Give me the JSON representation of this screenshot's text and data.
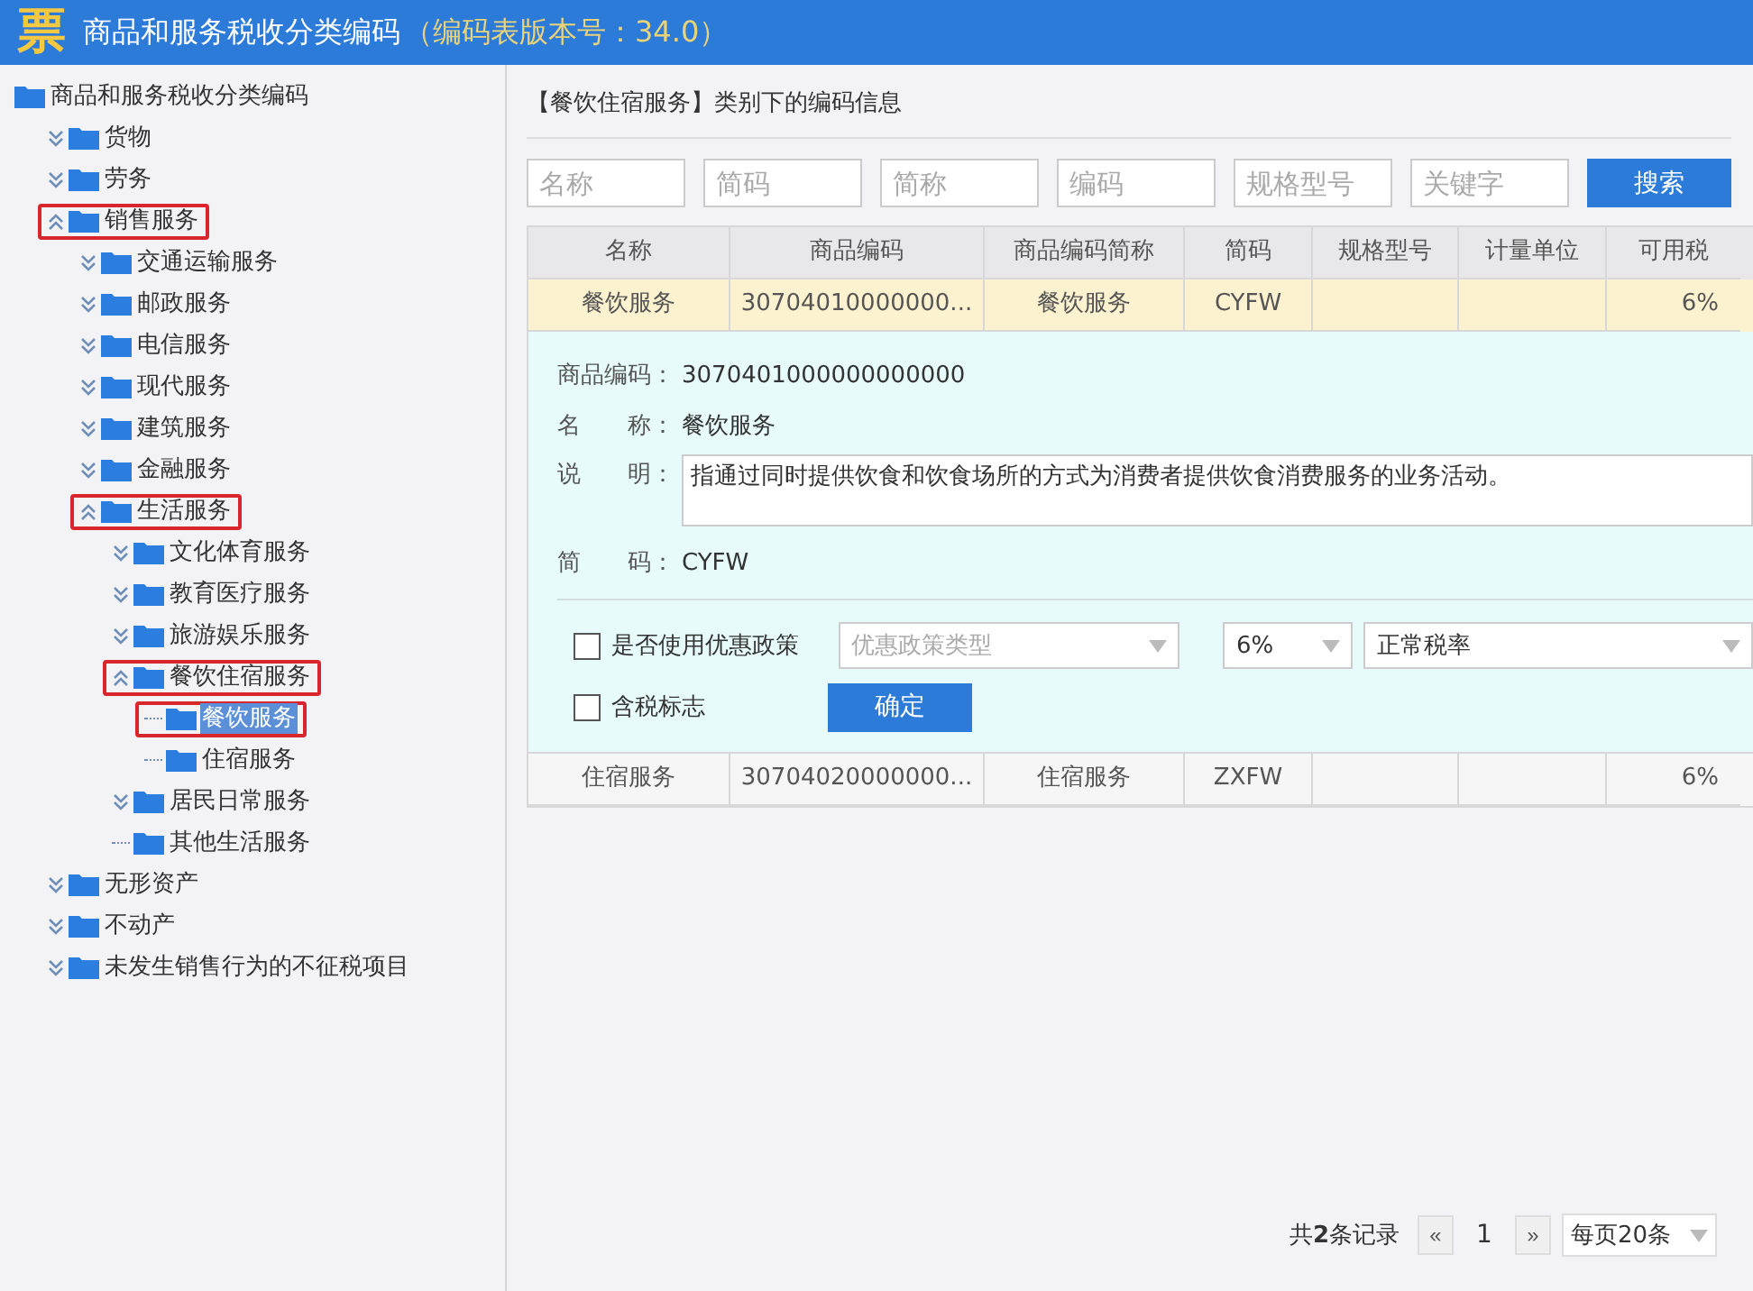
{
  "window": {
    "logo_char": "票",
    "title": "商品和服务税收分类编码",
    "version": "（编码表版本号：34.0）"
  },
  "tree": {
    "label": "商品和服务税收分类编码",
    "kind": "root",
    "selected": false,
    "marked": false,
    "children": [
      {
        "label": "货物",
        "kind": "folder",
        "expanded": false,
        "selected": false,
        "marked": false
      },
      {
        "label": "劳务",
        "kind": "folder",
        "expanded": false,
        "selected": false,
        "marked": false
      },
      {
        "label": "销售服务",
        "kind": "folder",
        "expanded": true,
        "selected": false,
        "marked": true,
        "children": [
          {
            "label": "交通运输服务",
            "kind": "folder",
            "expanded": false,
            "selected": false,
            "marked": false
          },
          {
            "label": "邮政服务",
            "kind": "folder",
            "expanded": false,
            "selected": false,
            "marked": false
          },
          {
            "label": "电信服务",
            "kind": "folder",
            "expanded": false,
            "selected": false,
            "marked": false
          },
          {
            "label": "现代服务",
            "kind": "folder",
            "expanded": false,
            "selected": false,
            "marked": false
          },
          {
            "label": "建筑服务",
            "kind": "folder",
            "expanded": false,
            "selected": false,
            "marked": false
          },
          {
            "label": "金融服务",
            "kind": "folder",
            "expanded": false,
            "selected": false,
            "marked": false
          },
          {
            "label": "生活服务",
            "kind": "folder",
            "expanded": true,
            "selected": false,
            "marked": true,
            "children": [
              {
                "label": "文化体育服务",
                "kind": "folder",
                "expanded": false,
                "selected": false,
                "marked": false
              },
              {
                "label": "教育医疗服务",
                "kind": "folder",
                "expanded": false,
                "selected": false,
                "marked": false
              },
              {
                "label": "旅游娱乐服务",
                "kind": "folder",
                "expanded": false,
                "selected": false,
                "marked": false
              },
              {
                "label": "餐饮住宿服务",
                "kind": "folder",
                "expanded": true,
                "selected": false,
                "marked": true,
                "children": [
                  {
                    "label": "餐饮服务",
                    "kind": "leaf",
                    "selected": true,
                    "marked": true
                  },
                  {
                    "label": "住宿服务",
                    "kind": "leaf",
                    "selected": false,
                    "marked": false
                  }
                ]
              },
              {
                "label": "居民日常服务",
                "kind": "folder",
                "expanded": false,
                "selected": false,
                "marked": false
              },
              {
                "label": "其他生活服务",
                "kind": "leaf",
                "selected": false,
                "marked": false
              }
            ]
          }
        ]
      },
      {
        "label": "无形资产",
        "kind": "folder",
        "expanded": false,
        "selected": false,
        "marked": false
      },
      {
        "label": "不动产",
        "kind": "folder",
        "expanded": false,
        "selected": false,
        "marked": false
      },
      {
        "label": "未发生销售行为的不征税项目",
        "kind": "folder",
        "expanded": false,
        "selected": false,
        "marked": false
      }
    ]
  },
  "heading": "【餐饮住宿服务】类别下的编码信息",
  "search": {
    "fields": [
      {
        "placeholder": "名称"
      },
      {
        "placeholder": "简码"
      },
      {
        "placeholder": "简称"
      },
      {
        "placeholder": "编码"
      },
      {
        "placeholder": "规格型号"
      },
      {
        "placeholder": "关键字"
      }
    ],
    "button": "搜索"
  },
  "table": {
    "columns": [
      "名称",
      "商品编码",
      "商品编码简称",
      "简码",
      "规格型号",
      "计量单位",
      "可用税"
    ],
    "rows": [
      {
        "cells": [
          "餐饮服务",
          "30704010000000...",
          "餐饮服务",
          "CYFW",
          "",
          "",
          "6%"
        ],
        "selected": true,
        "detail": {
          "fields": [
            {
              "label": "商品编码：",
              "value": "3070401000000000000"
            },
            {
              "label": "名　　称：",
              "value": "餐饮服务"
            }
          ],
          "description": {
            "label": "说　　明：",
            "value": "指通过同时提供饮食和饮食场所的方式为消费者提供饮食消费服务的业务活动。"
          },
          "short_code": {
            "label": "简　　码：",
            "value": "CYFW"
          },
          "preferential": {
            "label": "是否使用优惠政策",
            "checked": false
          },
          "policy_type": {
            "placeholder": "优惠政策类型"
          },
          "rate": "6%",
          "rate_type": "正常税率",
          "tax_included": {
            "label": "含税标志",
            "checked": false
          },
          "confirm": "确定"
        }
      },
      {
        "cells": [
          "住宿服务",
          "30704020000000...",
          "住宿服务",
          "ZXFW",
          "",
          "",
          "6%"
        ],
        "selected": false
      }
    ]
  },
  "pagination": {
    "prefix": "共",
    "count": "2",
    "suffix": "条记录",
    "prev": "«",
    "page": "1",
    "next": "»",
    "page_size": "每页20条"
  }
}
